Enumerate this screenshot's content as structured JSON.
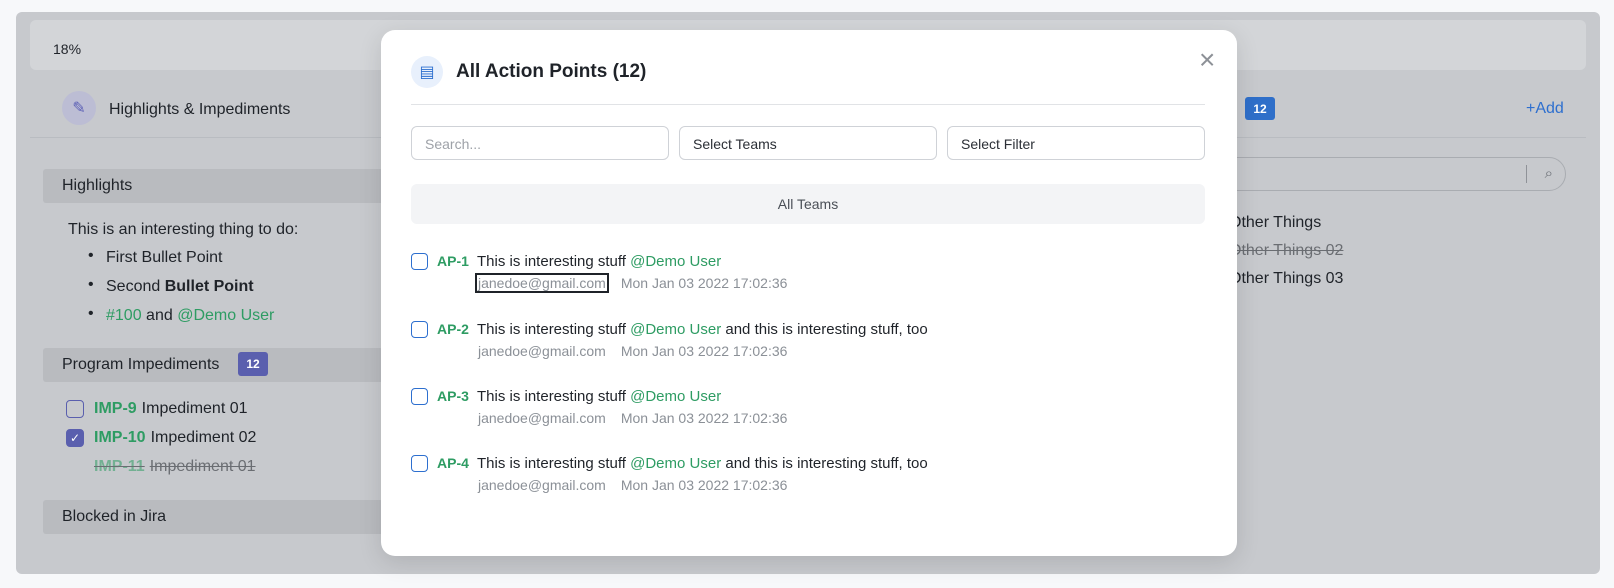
{
  "background": {
    "progress_text": "18%",
    "header_title": "Highlights & Impediments",
    "right_count": "12",
    "add_label": "+Add",
    "highlights_label": "Highlights",
    "highlights_intro": "This is an interesting thing to do:",
    "bullet_1": "First Bullet Point",
    "bullet_2_plain": "Second",
    "bullet_2_bold": "Bullet Point",
    "bullet_3_ref": "#100",
    "bullet_3_and": "and",
    "bullet_3_mention": "@Demo User",
    "impediments_label": "Program Impediments",
    "impediments_count": "12",
    "impediments": [
      {
        "key": "IMP-9",
        "title": "Impediment 01",
        "checked": false
      },
      {
        "key": "IMP-10",
        "title": "Impediment 02",
        "checked": true
      },
      {
        "key": "IMP-11",
        "title": "Impediment 01",
        "done": true
      }
    ],
    "blocked_label": "Blocked in Jira",
    "other_things": [
      "Other Things",
      "Other Things 02",
      "Other Things 03"
    ]
  },
  "modal": {
    "title": "All Action Points (12)",
    "search_placeholder": "Search...",
    "select_teams": "Select Teams",
    "select_filter": "Select Filter",
    "team_header": "All Teams",
    "items": [
      {
        "key": "AP-1",
        "text": "This is interesting stuff",
        "mention": "@Demo User",
        "suffix": "",
        "email": "janedoe@gmail.com",
        "date": "Mon Jan 03 2022 17:02:36"
      },
      {
        "key": "AP-2",
        "text": "This is interesting stuff",
        "mention": "@Demo User",
        "suffix": "and this is interesting stuff, too",
        "email": "janedoe@gmail.com",
        "date": "Mon Jan 03 2022 17:02:36"
      },
      {
        "key": "AP-3",
        "text": "This is interesting stuff",
        "mention": "@Demo User",
        "suffix": "",
        "email": "janedoe@gmail.com",
        "date": "Mon Jan 03 2022 17:02:36"
      },
      {
        "key": "AP-4",
        "text": "This is interesting stuff",
        "mention": "@Demo User",
        "suffix": "and this is interesting stuff, too",
        "email": "janedoe@gmail.com",
        "date": "Mon Jan 03 2022 17:02:36"
      }
    ]
  }
}
